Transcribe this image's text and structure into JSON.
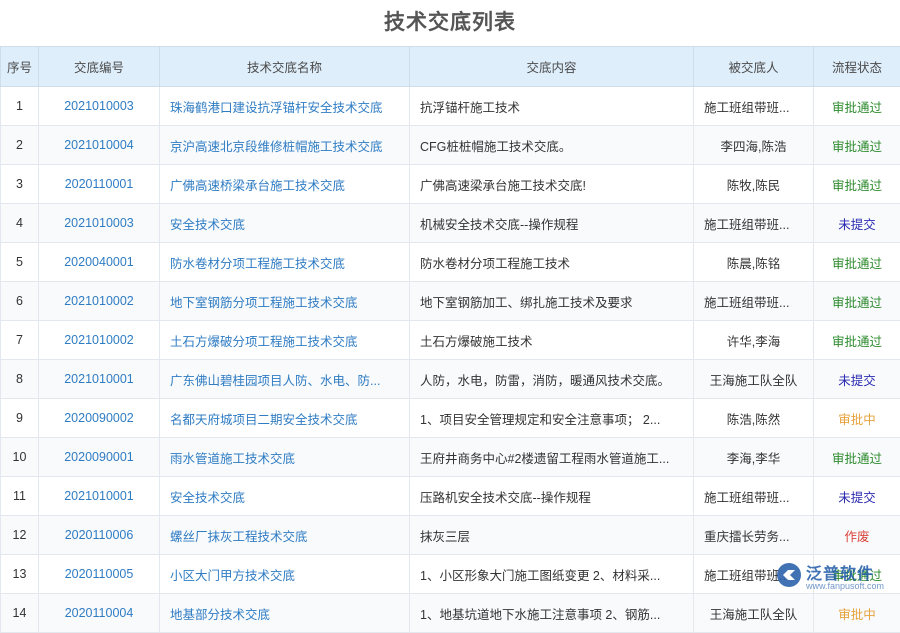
{
  "page": {
    "title": "技术交底列表"
  },
  "columns": [
    "序号",
    "交底编号",
    "技术交底名称",
    "交底内容",
    "被交底人",
    "流程状态"
  ],
  "rows": [
    {
      "no": "1",
      "code": "2021010003",
      "name": "珠海鹤港口建设抗浮锚杆安全技术交底",
      "content": "抗浮锚杆施工技术",
      "person": "施工班组带班...",
      "status": "审批通过",
      "status_type": "approved"
    },
    {
      "no": "2",
      "code": "2021010004",
      "name": "京沪高速北京段维修桩帽施工技术交底",
      "content": "CFG桩桩帽施工技术交底。",
      "person": "李四海,陈浩",
      "status": "审批通过",
      "status_type": "approved"
    },
    {
      "no": "3",
      "code": "2020110001",
      "name": "广佛高速桥梁承台施工技术交底",
      "content": "广佛高速梁承台施工技术交底!",
      "person": "陈牧,陈民",
      "status": "审批通过",
      "status_type": "approved"
    },
    {
      "no": "4",
      "code": "2021010003",
      "name": "安全技术交底",
      "content": "机械安全技术交底--操作规程",
      "person": "施工班组带班...",
      "status": "未提交",
      "status_type": "unsubmitted"
    },
    {
      "no": "5",
      "code": "2020040001",
      "name": "防水卷材分项工程施工技术交底",
      "content": "防水卷材分项工程施工技术",
      "person": "陈晨,陈铭",
      "status": "审批通过",
      "status_type": "approved"
    },
    {
      "no": "6",
      "code": "2021010002",
      "name": "地下室钢筋分项工程施工技术交底",
      "content": "地下室钢筋加工、绑扎施工技术及要求",
      "person": "施工班组带班...",
      "status": "审批通过",
      "status_type": "approved"
    },
    {
      "no": "7",
      "code": "2021010002",
      "name": "土石方爆破分项工程施工技术交底",
      "content": "土石方爆破施工技术",
      "person": "许华,李海",
      "status": "审批通过",
      "status_type": "approved"
    },
    {
      "no": "8",
      "code": "2021010001",
      "name": "广东佛山碧桂园项目人防、水电、防...",
      "content": "人防，水电，防雷，消防，暖通风技术交底。",
      "person": "王海施工队全队",
      "status": "未提交",
      "status_type": "unsubmitted"
    },
    {
      "no": "9",
      "code": "2020090002",
      "name": "名都天府城项目二期安全技术交底",
      "content": "1、项目安全管理规定和安全注意事项； 2...",
      "person": "陈浩,陈然",
      "status": "审批中",
      "status_type": "pending"
    },
    {
      "no": "10",
      "code": "2020090001",
      "name": "雨水管道施工技术交底",
      "content": "王府井商务中心#2楼遗留工程雨水管道施工...",
      "person": "李海,李华",
      "status": "审批通过",
      "status_type": "approved"
    },
    {
      "no": "11",
      "code": "2021010001",
      "name": "安全技术交底",
      "content": "压路机安全技术交底--操作规程",
      "person": "施工班组带班...",
      "status": "未提交",
      "status_type": "unsubmitted"
    },
    {
      "no": "12",
      "code": "2020110006",
      "name": "螺丝厂抹灰工程技术交底",
      "content": "抹灰三层",
      "person": "重庆擂长劳务...",
      "status": "作废",
      "status_type": "void"
    },
    {
      "no": "13",
      "code": "2020110005",
      "name": "小区大门甲方技术交底",
      "content": "1、小区形象大门施工图纸变更 2、材料采...",
      "person": "施工班组带班...",
      "status": "审批通过",
      "status_type": "approved"
    },
    {
      "no": "14",
      "code": "2020110004",
      "name": "地基部分技术交底",
      "content": "1、地基坑道地下水施工注意事项 2、钢筋...",
      "person": "王海施工队全队",
      "status": "审批中",
      "status_type": "pending"
    }
  ],
  "watermark": {
    "brand": "泛普软件",
    "url": "www.fanpusoft.com"
  },
  "colors": {
    "header_bg": "#dfeefb",
    "link": "#2f7cc3",
    "approved": "#2e8b2e",
    "unsubmitted": "#2a2ab0",
    "pending": "#e6a23c",
    "void": "#d9443a"
  }
}
